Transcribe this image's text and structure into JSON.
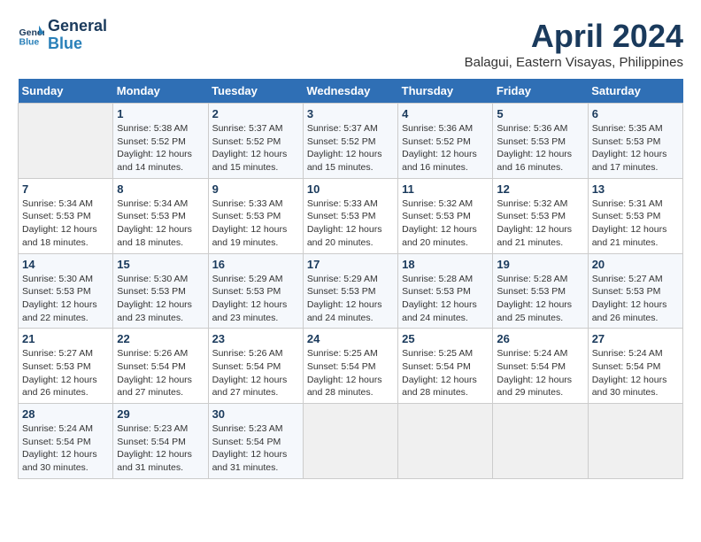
{
  "header": {
    "logo_line1": "General",
    "logo_line2": "Blue",
    "title": "April 2024",
    "subtitle": "Balagui, Eastern Visayas, Philippines"
  },
  "days_of_week": [
    "Sunday",
    "Monday",
    "Tuesday",
    "Wednesday",
    "Thursday",
    "Friday",
    "Saturday"
  ],
  "weeks": [
    [
      {
        "day": "",
        "info": ""
      },
      {
        "day": "1",
        "info": "Sunrise: 5:38 AM\nSunset: 5:52 PM\nDaylight: 12 hours\nand 14 minutes."
      },
      {
        "day": "2",
        "info": "Sunrise: 5:37 AM\nSunset: 5:52 PM\nDaylight: 12 hours\nand 15 minutes."
      },
      {
        "day": "3",
        "info": "Sunrise: 5:37 AM\nSunset: 5:52 PM\nDaylight: 12 hours\nand 15 minutes."
      },
      {
        "day": "4",
        "info": "Sunrise: 5:36 AM\nSunset: 5:52 PM\nDaylight: 12 hours\nand 16 minutes."
      },
      {
        "day": "5",
        "info": "Sunrise: 5:36 AM\nSunset: 5:53 PM\nDaylight: 12 hours\nand 16 minutes."
      },
      {
        "day": "6",
        "info": "Sunrise: 5:35 AM\nSunset: 5:53 PM\nDaylight: 12 hours\nand 17 minutes."
      }
    ],
    [
      {
        "day": "7",
        "info": "Sunrise: 5:34 AM\nSunset: 5:53 PM\nDaylight: 12 hours\nand 18 minutes."
      },
      {
        "day": "8",
        "info": "Sunrise: 5:34 AM\nSunset: 5:53 PM\nDaylight: 12 hours\nand 18 minutes."
      },
      {
        "day": "9",
        "info": "Sunrise: 5:33 AM\nSunset: 5:53 PM\nDaylight: 12 hours\nand 19 minutes."
      },
      {
        "day": "10",
        "info": "Sunrise: 5:33 AM\nSunset: 5:53 PM\nDaylight: 12 hours\nand 20 minutes."
      },
      {
        "day": "11",
        "info": "Sunrise: 5:32 AM\nSunset: 5:53 PM\nDaylight: 12 hours\nand 20 minutes."
      },
      {
        "day": "12",
        "info": "Sunrise: 5:32 AM\nSunset: 5:53 PM\nDaylight: 12 hours\nand 21 minutes."
      },
      {
        "day": "13",
        "info": "Sunrise: 5:31 AM\nSunset: 5:53 PM\nDaylight: 12 hours\nand 21 minutes."
      }
    ],
    [
      {
        "day": "14",
        "info": "Sunrise: 5:30 AM\nSunset: 5:53 PM\nDaylight: 12 hours\nand 22 minutes."
      },
      {
        "day": "15",
        "info": "Sunrise: 5:30 AM\nSunset: 5:53 PM\nDaylight: 12 hours\nand 23 minutes."
      },
      {
        "day": "16",
        "info": "Sunrise: 5:29 AM\nSunset: 5:53 PM\nDaylight: 12 hours\nand 23 minutes."
      },
      {
        "day": "17",
        "info": "Sunrise: 5:29 AM\nSunset: 5:53 PM\nDaylight: 12 hours\nand 24 minutes."
      },
      {
        "day": "18",
        "info": "Sunrise: 5:28 AM\nSunset: 5:53 PM\nDaylight: 12 hours\nand 24 minutes."
      },
      {
        "day": "19",
        "info": "Sunrise: 5:28 AM\nSunset: 5:53 PM\nDaylight: 12 hours\nand 25 minutes."
      },
      {
        "day": "20",
        "info": "Sunrise: 5:27 AM\nSunset: 5:53 PM\nDaylight: 12 hours\nand 26 minutes."
      }
    ],
    [
      {
        "day": "21",
        "info": "Sunrise: 5:27 AM\nSunset: 5:53 PM\nDaylight: 12 hours\nand 26 minutes."
      },
      {
        "day": "22",
        "info": "Sunrise: 5:26 AM\nSunset: 5:54 PM\nDaylight: 12 hours\nand 27 minutes."
      },
      {
        "day": "23",
        "info": "Sunrise: 5:26 AM\nSunset: 5:54 PM\nDaylight: 12 hours\nand 27 minutes."
      },
      {
        "day": "24",
        "info": "Sunrise: 5:25 AM\nSunset: 5:54 PM\nDaylight: 12 hours\nand 28 minutes."
      },
      {
        "day": "25",
        "info": "Sunrise: 5:25 AM\nSunset: 5:54 PM\nDaylight: 12 hours\nand 28 minutes."
      },
      {
        "day": "26",
        "info": "Sunrise: 5:24 AM\nSunset: 5:54 PM\nDaylight: 12 hours\nand 29 minutes."
      },
      {
        "day": "27",
        "info": "Sunrise: 5:24 AM\nSunset: 5:54 PM\nDaylight: 12 hours\nand 30 minutes."
      }
    ],
    [
      {
        "day": "28",
        "info": "Sunrise: 5:24 AM\nSunset: 5:54 PM\nDaylight: 12 hours\nand 30 minutes."
      },
      {
        "day": "29",
        "info": "Sunrise: 5:23 AM\nSunset: 5:54 PM\nDaylight: 12 hours\nand 31 minutes."
      },
      {
        "day": "30",
        "info": "Sunrise: 5:23 AM\nSunset: 5:54 PM\nDaylight: 12 hours\nand 31 minutes."
      },
      {
        "day": "",
        "info": ""
      },
      {
        "day": "",
        "info": ""
      },
      {
        "day": "",
        "info": ""
      },
      {
        "day": "",
        "info": ""
      }
    ]
  ]
}
